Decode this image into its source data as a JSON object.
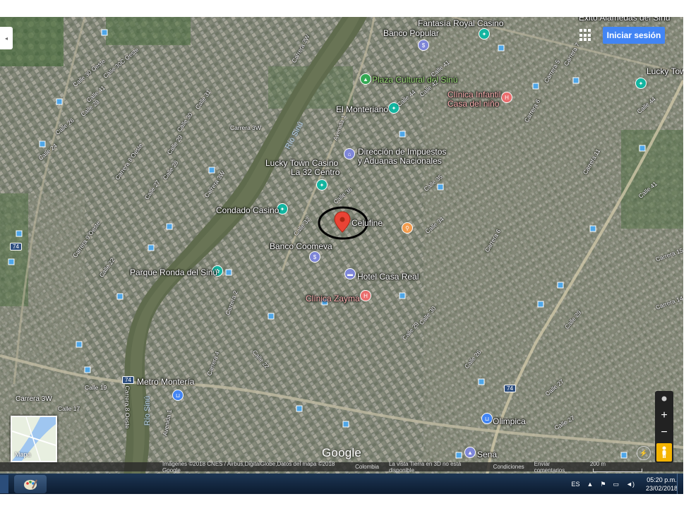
{
  "colors": {
    "accent": "#4285f4",
    "marker": "#ea4335",
    "taskbar": "#0f223a",
    "river": "#556548"
  },
  "header": {
    "signin_label": "Iniciar sesión",
    "apps_icon": "apps-grid-icon",
    "collapse_icon": "chevron-left-icon"
  },
  "map": {
    "places": [
      "Fantasía Royal Casino",
      "Banco Popular",
      "Plaza Cultural del Sinú",
      "Clínica Infantil",
      "Casa del niño",
      "El Monteriano",
      "Dirección de Impuestos",
      "y Aduanas Nacionales",
      "Lucky Town Casino",
      "La 32 Centro",
      "Condado Casino",
      "Celufine",
      "Banco Coomeva",
      "Hotel Casa Real",
      "Clínica Zayma",
      "Parque Ronda del Sinú",
      "Metro Montería",
      "Olimpica",
      "Sena",
      "Lucky Town Gra",
      "Éxito Alamedas del Sinú"
    ],
    "river_labels": [
      "Río Sinú",
      "Río Sinú"
    ],
    "streets": [
      "Calle 30C Oeste",
      "Calle 30 Oeste",
      "Calle 41",
      "Calle 28",
      "Calle 26",
      "Calle 24",
      "Carrera 3W",
      "Carrera 3W",
      "Carrera 3W",
      "Calle 31",
      "Calle 30",
      "Calle 29",
      "Calle 28",
      "Calle 27",
      "Calle 22",
      "Carrera 8 Oeste",
      "Carrera 9 Oeste",
      "Calle 44",
      "Calle 41",
      "Calle 42",
      "Calle 35",
      "Calle 36",
      "Calle 32",
      "Calle 34",
      "Calle 30",
      "Calle 29",
      "Calle 26",
      "Calle 27",
      "Calle 22",
      "Calle 17",
      "Calle 19",
      "Carrera 8 Oeste",
      "Carrera 3W",
      "Avenida 1",
      "Avenida 1",
      "Carrera 2",
      "Carrera 4",
      "Carrera 6",
      "Carrera 11",
      "Carrera 14",
      "Carrera 15",
      "Calle 29",
      "Calle 27",
      "Calle 44",
      "Carrera 6",
      "Carrera 5",
      "Carrera 7",
      "Calle 41"
    ],
    "road_shields": [
      "74",
      "74",
      "74",
      "74"
    ],
    "google_logo": "Google",
    "marker_icon": "map-pin-icon"
  },
  "minimap": {
    "label": "Mapa"
  },
  "controls": {
    "location_icon": "my-location-icon",
    "zoom_in": "+",
    "zoom_out": "−",
    "pegman_icon": "pegman-icon",
    "compass_icon": "compass-icon"
  },
  "attribution": {
    "imagery": "Imágenes ©2018 CNES / Airbus,DigitalGlobe,Datos del mapa ©2018 Google",
    "country": "Colombia",
    "earth3d": "La vista Tierra en 3D no está disponible",
    "terms": "Condiciones",
    "feedback": "Enviar comentarios",
    "scale": "200 m"
  },
  "taskbar": {
    "start_icon": "windows-start-icon",
    "lang": "ES",
    "time": "05:20 p.m.",
    "date": "23/02/2018"
  }
}
